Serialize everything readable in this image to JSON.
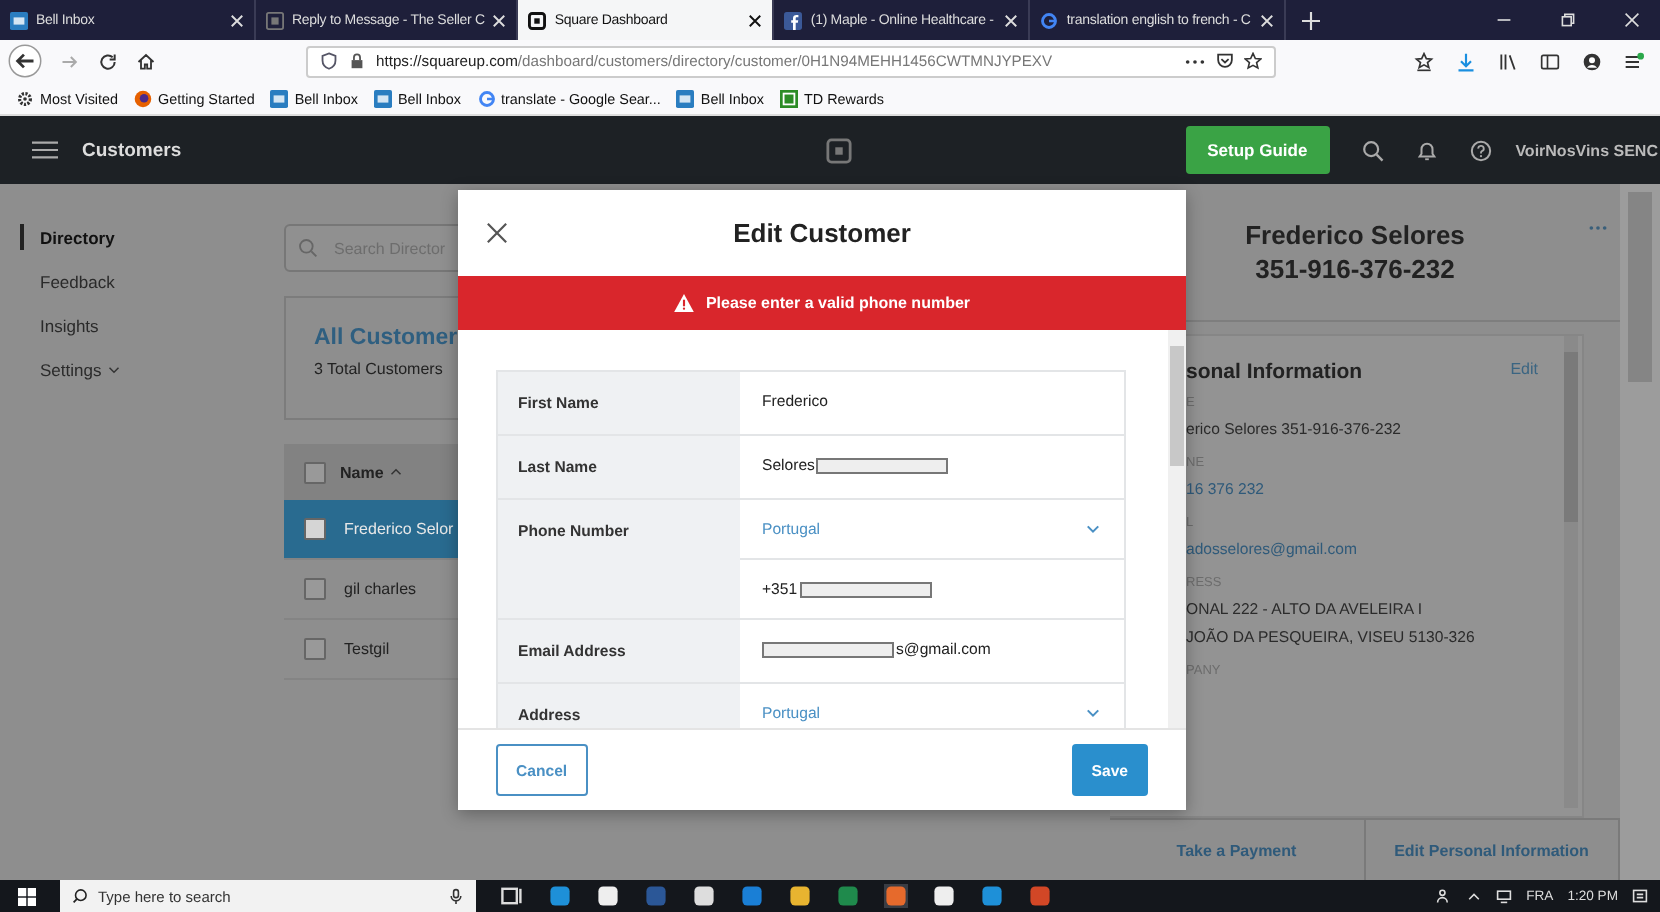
{
  "browser": {
    "tabs": [
      {
        "title": "Bell Inbox",
        "kind": "bell",
        "selected": false
      },
      {
        "title": "Reply to Message - The Seller C",
        "kind": "page",
        "selected": false
      },
      {
        "title": "Square Dashboard",
        "kind": "square",
        "selected": true
      },
      {
        "title": "(1) Maple - Online Healthcare -",
        "kind": "facebook",
        "selected": false
      },
      {
        "title": "translation english to french - C",
        "kind": "google",
        "selected": false
      }
    ],
    "url_host": "https://squareup.com",
    "url_path": "/dashboard/customers/directory/customer/0H1N94MEHH1456CWTMNJYPEXV",
    "bookmarks": [
      {
        "label": "Most Visited",
        "kind": "gear"
      },
      {
        "label": "Getting Started",
        "kind": "firefox"
      },
      {
        "label": "Bell Inbox",
        "kind": "bell"
      },
      {
        "label": "Bell Inbox",
        "kind": "bell"
      },
      {
        "label": "translate - Google Sear...",
        "kind": "google"
      },
      {
        "label": "Bell Inbox",
        "kind": "bell"
      },
      {
        "label": "TD Rewards",
        "kind": "td"
      }
    ]
  },
  "app_header": {
    "title": "Customers",
    "setup_button": "Setup Guide",
    "account": "VoirNosVins SENC"
  },
  "sidebar": {
    "items": [
      {
        "label": "Directory",
        "selected": true,
        "has_menu": false
      },
      {
        "label": "Feedback",
        "selected": false,
        "has_menu": false
      },
      {
        "label": "Insights",
        "selected": false,
        "has_menu": false
      },
      {
        "label": "Settings",
        "selected": false,
        "has_menu": true
      }
    ]
  },
  "directory": {
    "search_placeholder": "Search Director",
    "card_title": "All Customer",
    "card_subtitle": "3 Total Customers",
    "column": "Name",
    "sort_ascending": true,
    "all_checked": false,
    "rows": [
      {
        "name": "Frederico Selor",
        "selected": true,
        "checked": false
      },
      {
        "name": "gil charles",
        "selected": false,
        "checked": false
      },
      {
        "name": "Testgil",
        "selected": false,
        "checked": false
      }
    ]
  },
  "profile": {
    "name": "Frederico Selores",
    "phone": "351-916-376-232",
    "section_title": "sonal Information",
    "edit_link": "Edit",
    "fields": [
      {
        "label": "E",
        "values": [
          "erico Selores 351-916-376-232"
        ],
        "link": false
      },
      {
        "label": "NE",
        "values": [
          "16 376 232"
        ],
        "link": true
      },
      {
        "label": "L",
        "values": [
          "adosselores@gmail.com"
        ],
        "link": true
      },
      {
        "label": "RESS",
        "values": [
          "ONAL 222 - ALTO DA AVELEIRA I",
          "JOÃO DA PESQUEIRA, VISEU 5130-326"
        ],
        "link": false
      },
      {
        "label": "PANY"
      }
    ],
    "actions": [
      "Take a Payment",
      "Edit Personal Information"
    ]
  },
  "modal": {
    "title": "Edit Customer",
    "error": "Please enter a valid phone number",
    "rows": [
      {
        "label": "First Name",
        "fields": [
          {
            "kind": "text",
            "value": "Frederico"
          }
        ]
      },
      {
        "label": "Last Name",
        "fields": [
          {
            "kind": "text",
            "value": "Selores",
            "redacted_after": true
          }
        ]
      },
      {
        "label": "Phone Number",
        "fields": [
          {
            "kind": "select",
            "value": "Portugal"
          },
          {
            "kind": "text",
            "value": "+351",
            "redacted_after": true
          }
        ]
      },
      {
        "label": "Email Address",
        "fields": [
          {
            "kind": "text",
            "value": "s@gmail.com",
            "redacted_before": true
          }
        ]
      },
      {
        "label": "Address",
        "fields": [
          {
            "kind": "select",
            "value": "Portugal"
          }
        ]
      }
    ],
    "cancel": "Cancel",
    "save": "Save"
  },
  "taskbar": {
    "search_placeholder": "Type here to search",
    "language": "FRA",
    "time": "1:20 PM"
  }
}
